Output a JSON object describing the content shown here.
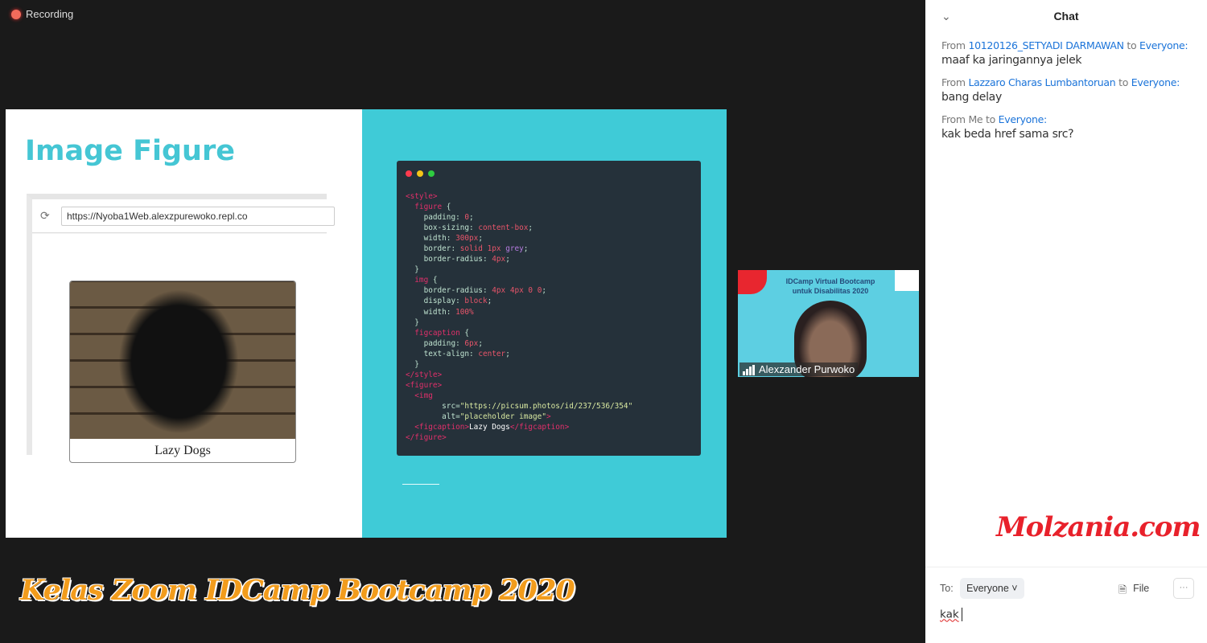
{
  "recording": {
    "label": "Recording",
    "color": "#f26b5b"
  },
  "slide": {
    "title": "Image Figure",
    "browser": {
      "url": "https://Nyoba1Web.alexzpurewoko.repl.co",
      "caption": "Lazy Dogs"
    },
    "code_lines": [
      [
        [
          "<style>",
          "tag"
        ]
      ],
      [
        [
          "  figure",
          "tag"
        ],
        [
          " {",
          "prop"
        ]
      ],
      [
        [
          "    padding: ",
          "prop"
        ],
        [
          "0",
          "val"
        ],
        [
          ";",
          "prop"
        ]
      ],
      [
        [
          "    box-sizing: ",
          "prop"
        ],
        [
          "content-box",
          "val"
        ],
        [
          ";",
          "prop"
        ]
      ],
      [
        [
          "    width: ",
          "prop"
        ],
        [
          "300px",
          "val"
        ],
        [
          ";",
          "prop"
        ]
      ],
      [
        [
          "    border: ",
          "prop"
        ],
        [
          "solid 1px ",
          "val"
        ],
        [
          "grey",
          "kw"
        ],
        [
          ";",
          "prop"
        ]
      ],
      [
        [
          "    border-radius: ",
          "prop"
        ],
        [
          "4px",
          "val"
        ],
        [
          ";",
          "prop"
        ]
      ],
      [
        [
          "  }",
          "prop"
        ]
      ],
      [
        [
          "  img",
          "tag"
        ],
        [
          " {",
          "prop"
        ]
      ],
      [
        [
          "    border-radius: ",
          "prop"
        ],
        [
          "4px 4px 0 0",
          "val"
        ],
        [
          ";",
          "prop"
        ]
      ],
      [
        [
          "    display: ",
          "prop"
        ],
        [
          "block",
          "val"
        ],
        [
          ";",
          "prop"
        ]
      ],
      [
        [
          "    width: ",
          "prop"
        ],
        [
          "100%",
          "val"
        ]
      ],
      [
        [
          "  }",
          "prop"
        ]
      ],
      [
        [
          "  figcaption",
          "tag"
        ],
        [
          " {",
          "prop"
        ]
      ],
      [
        [
          "    padding: ",
          "prop"
        ],
        [
          "6px",
          "val"
        ],
        [
          ";",
          "prop"
        ]
      ],
      [
        [
          "    text-align: ",
          "prop"
        ],
        [
          "center",
          "val"
        ],
        [
          ";",
          "prop"
        ]
      ],
      [
        [
          "  }",
          "prop"
        ]
      ],
      [
        [
          "</style>",
          "tag"
        ]
      ],
      [
        [
          "<figure>",
          "tag"
        ]
      ],
      [
        [
          "  <img",
          "tag"
        ]
      ],
      [
        [
          "        src=",
          "prop"
        ],
        [
          "\"https://picsum.photos/id/237/536/354\"",
          "str"
        ]
      ],
      [
        [
          "        alt=",
          "prop"
        ],
        [
          "\"placeholder image\"",
          "str"
        ],
        [
          ">",
          "tag"
        ]
      ],
      [
        [
          "  <figcaption>",
          "tag"
        ],
        [
          "Lazy Dogs",
          "txt"
        ],
        [
          "</figcaption>",
          "tag"
        ]
      ],
      [
        [
          "</figure>",
          "tag"
        ]
      ]
    ],
    "colors": {
      "teal": "#3fcbd7",
      "title": "#45c6d4",
      "code_bg": "#25313a"
    }
  },
  "video": {
    "banner_line1": "IDCamp Virtual Bootcamp",
    "banner_line2": "untuk Disabilitas 2020",
    "participant_name": "Alexzander Purwoko"
  },
  "chat": {
    "title": "Chat",
    "messages": [
      {
        "from_prefix": "From",
        "sender": "10120126_SETYADI DARMAWAN",
        "to_word": "to",
        "recipient": "Everyone:",
        "text": "maaf ka jaringannya jelek"
      },
      {
        "from_prefix": "From",
        "sender": "Lazzaro Charas Lumbantoruan",
        "to_word": "to",
        "recipient": "Everyone:",
        "text": "bang delay"
      },
      {
        "from_prefix": "From Me",
        "sender": "",
        "to_word": "to",
        "recipient": "Everyone:",
        "text": "kak beda href sama src?"
      }
    ],
    "to_label": "To:",
    "recipient_select": "Everyone",
    "file_label": "File",
    "more_label": "···",
    "input_value": "kak",
    "link_color": "#1a73d9"
  },
  "watermarks": {
    "site": "Molzania.com",
    "caption": "Kelas Zoom IDCamp Bootcamp 2020"
  }
}
